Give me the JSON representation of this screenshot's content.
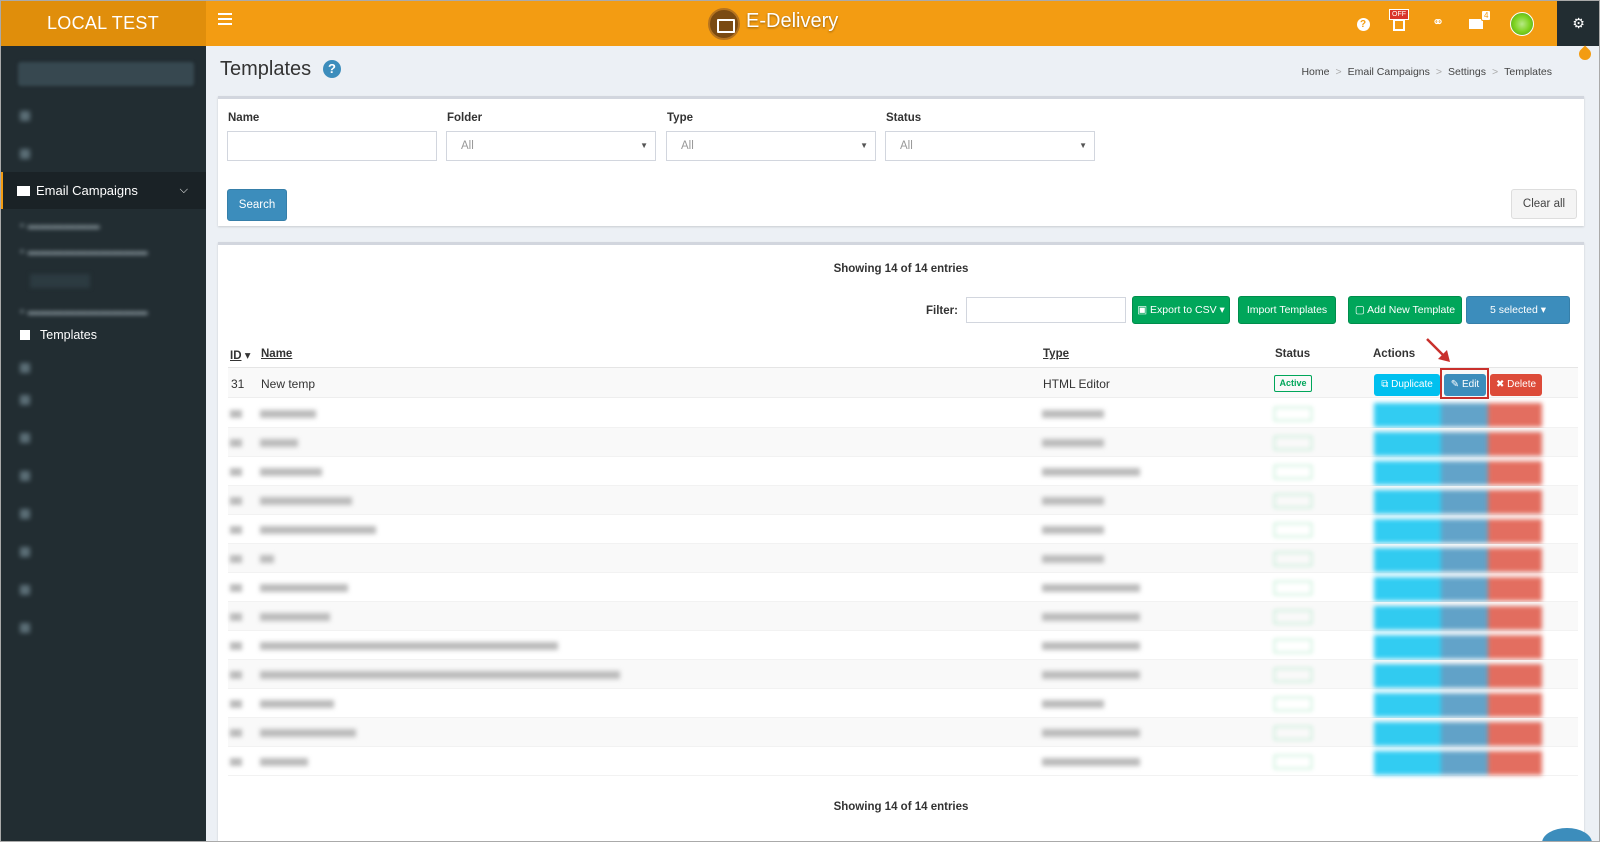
{
  "brand": "LOCAL TEST",
  "app": {
    "name": "E-Delivery"
  },
  "topbar": {
    "off_badge": "OFF",
    "mail_count": "4"
  },
  "sidebar": {
    "active_item": "Email Campaigns",
    "current_subitem": "Templates"
  },
  "page": {
    "title": "Templates",
    "breadcrumb": [
      "Home",
      "Email Campaigns",
      "Settings",
      "Templates"
    ]
  },
  "filters": {
    "name_label": "Name",
    "folder_label": "Folder",
    "folder_value": "All",
    "type_label": "Type",
    "type_value": "All",
    "status_label": "Status",
    "status_value": "All",
    "search_button": "Search",
    "clear_button": "Clear all"
  },
  "list": {
    "showing": "Showing 14 of 14 entries",
    "filter_label": "Filter:",
    "export_button": "Export to CSV",
    "import_button": "Import Templates",
    "add_button": "Add New Template",
    "selected_button": "5 selected",
    "columns": {
      "id": "ID",
      "name": "Name",
      "type": "Type",
      "status": "Status",
      "actions": "Actions"
    },
    "rows": [
      {
        "id": "31",
        "name": "New temp",
        "type": "HTML Editor",
        "status": "Active",
        "duplicate": "Duplicate",
        "edit": "Edit",
        "delete": "Delete"
      }
    ]
  },
  "colors": {
    "topbar": "#f39c12",
    "brand_bg": "#e08e0b",
    "sidebar": "#222d32",
    "primary": "#3c8dbc",
    "success": "#00a65a",
    "info": "#00c0ef",
    "danger": "#dd4b39"
  }
}
